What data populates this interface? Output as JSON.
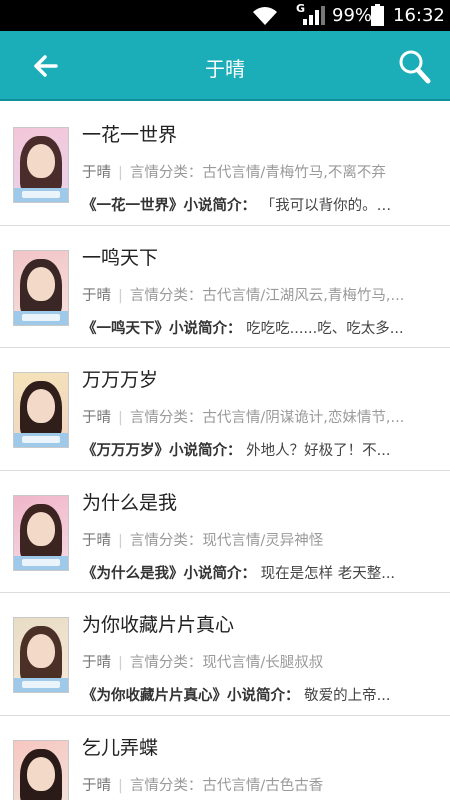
{
  "status_bar": {
    "network": "G",
    "battery": "99%",
    "time": "16:32"
  },
  "app_bar": {
    "title": "于晴",
    "back_icon": "arrow-left-icon",
    "search_icon": "search-icon"
  },
  "books": [
    {
      "title": "一花一世界",
      "author": "于晴",
      "category": "言情分类：古代言情/青梅竹马,不离不弃",
      "desc_label": "《一花一世界》小说简介：",
      "desc": "「我可以背你的。…"
    },
    {
      "title": "一鸣天下",
      "author": "于晴",
      "category": "言情分类：古代言情/江湖风云,青梅竹马,...",
      "desc_label": "《一鸣天下》小说简介：",
      "desc": "吃吃吃......吃、吃太多..."
    },
    {
      "title": "万万万岁",
      "author": "于晴",
      "category": "言情分类：古代言情/阴谋诡计,恋妹情节,...",
      "desc_label": "《万万万岁》小说简介：",
      "desc": "外地人？好极了！不..."
    },
    {
      "title": "为什么是我",
      "author": "于晴",
      "category": "言情分类：现代言情/灵异神怪",
      "desc_label": "《为什么是我》小说简介：",
      "desc": "现在是怎样  老天整..."
    },
    {
      "title": "为你收藏片片真心",
      "author": "于晴",
      "category": "言情分类：现代言情/长腿叔叔",
      "desc_label": "《为你收藏片片真心》小说简介：",
      "desc": "敬爱的上帝..."
    },
    {
      "title": "乞儿弄蝶",
      "author": "于晴",
      "category": "言情分类：古代言情/古色古香",
      "desc_label": "",
      "desc": ""
    }
  ]
}
